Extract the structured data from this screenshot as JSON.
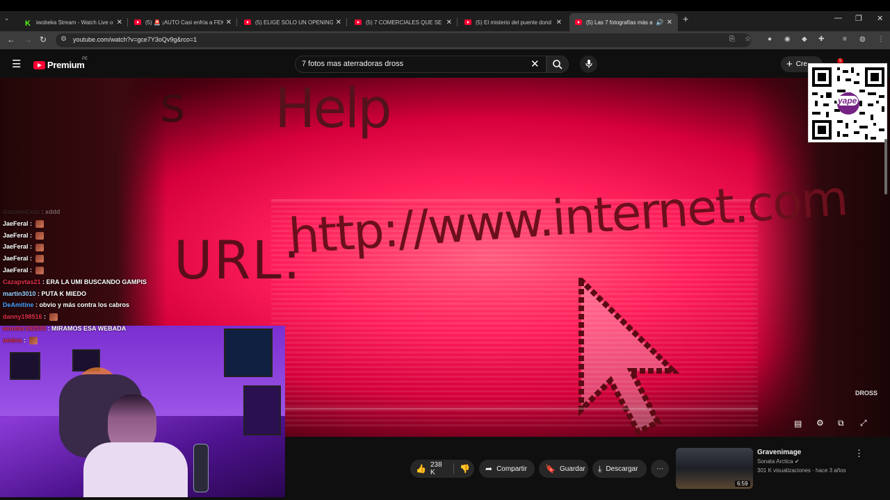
{
  "browser": {
    "tabs": [
      {
        "title": "iwobeka Stream - Watch Live o",
        "kind": "kick"
      },
      {
        "title": "(5) 🚨 ¡AUTO Casi enfría a FEKA",
        "kind": "youtube"
      },
      {
        "title": "(5) ELIGE SOLO UN OPENING D",
        "kind": "youtube"
      },
      {
        "title": "(5) 7 COMERCIALES QUE SE PR",
        "kind": "youtube"
      },
      {
        "title": "(5) El misterio del puente dond",
        "kind": "youtube"
      },
      {
        "title": "(5) Las 7 fotografías más at",
        "kind": "youtube",
        "active": true
      }
    ],
    "url": "youtube.com/watch?v=gce7Y3oQv9g&rco=1"
  },
  "youtube": {
    "logo_text": "Premium",
    "country_code": "PE",
    "search_query": "7 fotos mas aterradoras dross",
    "create_label": "Cre",
    "notifications_count": "5"
  },
  "video_frame": {
    "help_text": "Help",
    "s_text": "s",
    "url_label": "URL:",
    "url_text": "http://www.internet.com",
    "qr_brand": "yape",
    "watermark": "DROSS"
  },
  "chat": [
    {
      "user": "GatoeinCola",
      "message": "xddd",
      "user_color": "#555555",
      "faded": true
    },
    {
      "user": "JaeFeral",
      "message": "",
      "user_color": "#ffffff",
      "emote": true
    },
    {
      "user": "JaeFeral",
      "message": "",
      "user_color": "#ffffff",
      "emote": true
    },
    {
      "user": "JaeFeral",
      "message": "",
      "user_color": "#ffffff",
      "emote": true
    },
    {
      "user": "JaeFeral",
      "message": "",
      "user_color": "#ffffff",
      "emote": true
    },
    {
      "user": "JaeFeral",
      "message": "",
      "user_color": "#ffffff",
      "emote": true
    },
    {
      "user": "Cazapvtas21",
      "message": "ERA LA UMI BUSCANDO GAMPIS",
      "user_color": "#e0304a"
    },
    {
      "user": "martin3010",
      "message": "PUTA K MIEDO",
      "user_color": "#9ad0ff"
    },
    {
      "user": "DeAmitine",
      "message": "obvio y más contra los cabros",
      "user_color": "#4aa0ff"
    },
    {
      "user": "danny198516",
      "message": "",
      "user_color": "#e0304a",
      "emote": true
    },
    {
      "user": "wonder192933",
      "message": "MIRAMOS ESA WEBADA",
      "user_color": "#e0304a"
    },
    {
      "user": "ombra",
      "message": "",
      "user_color": "#e0304a",
      "emote": true
    }
  ],
  "actions": {
    "likes": "238 K",
    "share": "Compartir",
    "save": "Guardar",
    "download": "Descargar"
  },
  "recommendation": {
    "title": "Gravenimage",
    "channel": "Sonata Arctica",
    "meta": "301 K visualizaciones · hace 3 años",
    "duration": "6:59"
  }
}
